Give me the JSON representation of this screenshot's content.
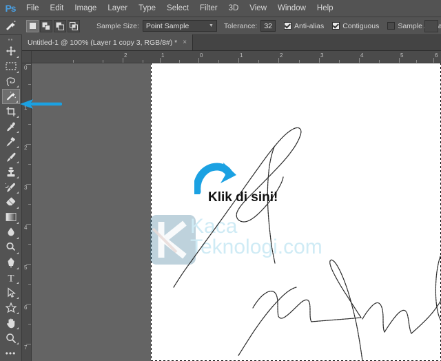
{
  "app": {
    "logo": "Ps",
    "name": "Adobe Photoshop"
  },
  "menubar": {
    "items": [
      {
        "label": "File"
      },
      {
        "label": "Edit"
      },
      {
        "label": "Image"
      },
      {
        "label": "Layer"
      },
      {
        "label": "Type"
      },
      {
        "label": "Select"
      },
      {
        "label": "Filter"
      },
      {
        "label": "3D"
      },
      {
        "label": "View"
      },
      {
        "label": "Window"
      },
      {
        "label": "Help"
      }
    ]
  },
  "options_bar": {
    "active_tool": "magic-wand-tool",
    "selection_modes": [
      {
        "name": "new-selection",
        "active": true
      },
      {
        "name": "add-to-selection",
        "active": false
      },
      {
        "name": "subtract-from-selection",
        "active": false
      },
      {
        "name": "intersect-with-selection",
        "active": false
      }
    ],
    "sample_size_label": "Sample Size:",
    "sample_size_value": "Point Sample",
    "tolerance_label": "Tolerance:",
    "tolerance_value": "32",
    "checkboxes": [
      {
        "label": "Anti-alias",
        "checked": true
      },
      {
        "label": "Contiguous",
        "checked": true
      },
      {
        "label": "Sample All Layers",
        "checked": false
      }
    ]
  },
  "document_tab": {
    "title": "Untitled-1 @ 100% (Layer 1 copy 3, RGB/8#) *",
    "close_glyph": "×"
  },
  "toolbar": {
    "grip": "▪▪",
    "tools": [
      {
        "name": "move-tool",
        "has_flyout": true,
        "selected": false
      },
      {
        "name": "rectangular-marquee-tool",
        "has_flyout": true,
        "selected": false
      },
      {
        "name": "lasso-tool",
        "has_flyout": true,
        "selected": false
      },
      {
        "name": "magic-wand-tool",
        "has_flyout": true,
        "selected": true
      },
      {
        "name": "crop-tool",
        "has_flyout": true,
        "selected": false
      },
      {
        "name": "eyedropper-tool",
        "has_flyout": true,
        "selected": false
      },
      {
        "name": "spot-healing-brush-tool",
        "has_flyout": true,
        "selected": false
      },
      {
        "name": "brush-tool",
        "has_flyout": true,
        "selected": false
      },
      {
        "name": "clone-stamp-tool",
        "has_flyout": true,
        "selected": false
      },
      {
        "name": "history-brush-tool",
        "has_flyout": true,
        "selected": false
      },
      {
        "name": "eraser-tool",
        "has_flyout": true,
        "selected": false
      },
      {
        "name": "gradient-tool",
        "has_flyout": true,
        "selected": false
      },
      {
        "name": "blur-tool",
        "has_flyout": true,
        "selected": false
      },
      {
        "name": "dodge-tool",
        "has_flyout": true,
        "selected": false
      },
      {
        "name": "pen-tool",
        "has_flyout": true,
        "selected": false
      },
      {
        "name": "horizontal-type-tool",
        "has_flyout": true,
        "selected": false
      },
      {
        "name": "path-selection-tool",
        "has_flyout": true,
        "selected": false
      },
      {
        "name": "custom-shape-tool",
        "has_flyout": true,
        "selected": false
      },
      {
        "name": "hand-tool",
        "has_flyout": true,
        "selected": false
      },
      {
        "name": "zoom-tool",
        "has_flyout": true,
        "selected": false
      },
      {
        "name": "edit-toolbar-button",
        "has_flyout": false,
        "selected": false
      }
    ],
    "more_glyph": "•••"
  },
  "rulers": {
    "horizontal_labels": [
      "2",
      "1",
      "0",
      "1",
      "2",
      "3",
      "4",
      "5",
      "6"
    ],
    "vertical_labels": [
      "0",
      "1",
      "2",
      "3",
      "4",
      "5",
      "6",
      "7"
    ],
    "unit": "inches"
  },
  "canvas": {
    "background": "#ffffff",
    "workspace_background": "#646464",
    "has_selection_marquee": true,
    "content": "handwritten-signature"
  },
  "annotations": {
    "callout_text": "Klik di sini!",
    "callout_color": "#111111",
    "arrow_color": "#1ba1e2",
    "curved_arrow_name": "curved-arrow-annotation",
    "pointer_arrow_name": "left-pointing-arrow-annotation",
    "pointer_target": "magic-wand-tool"
  },
  "watermark": {
    "line1": "Kaca",
    "line2": "Teknologi.com",
    "color": "#8fd0e8",
    "logo_name": "kaca-teknologi-logo"
  },
  "colors": {
    "chrome": "#535353",
    "panel": "#444444",
    "ruler": "#4b4b4b",
    "accent_blue": "#1ba1e2",
    "ps_logo_blue": "#4a9ee0"
  }
}
